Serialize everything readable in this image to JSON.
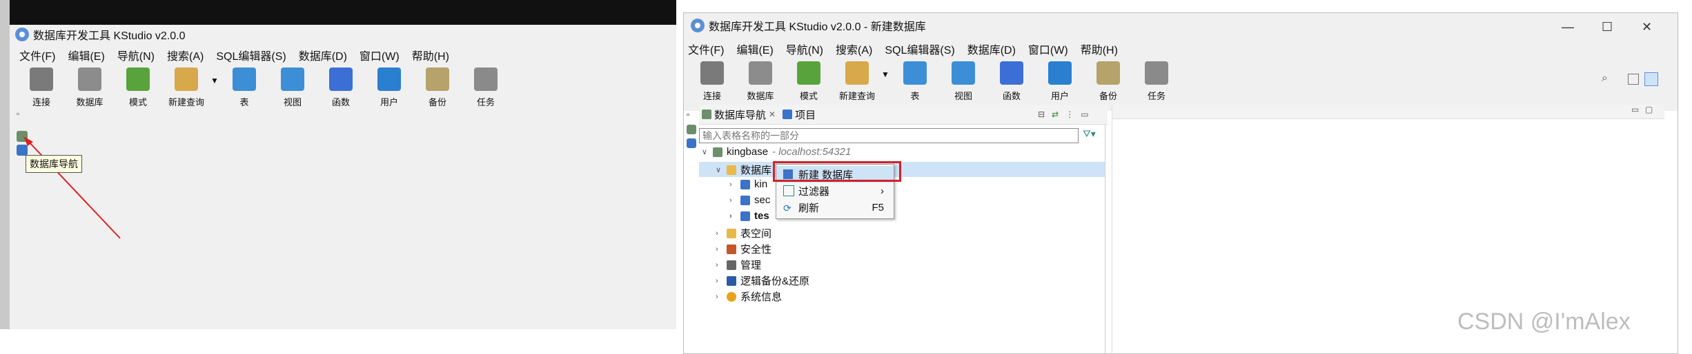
{
  "app": {
    "title_left": "数据库开发工具 KStudio v2.0.0",
    "title_right": "数据库开发工具 KStudio v2.0.0 - 新建数据库"
  },
  "menu": [
    "文件(F)",
    "编辑(E)",
    "导航(N)",
    "搜索(A)",
    "SQL编辑器(S)",
    "数据库(D)",
    "窗口(W)",
    "帮助(H)"
  ],
  "toolbar": [
    {
      "label": "连接",
      "icon": "plug-icon",
      "color": "#7a7a7a"
    },
    {
      "label": "数据库",
      "icon": "database-icon",
      "color": "#8c8c8c"
    },
    {
      "label": "模式",
      "icon": "schema-icon",
      "color": "#58a33b"
    },
    {
      "label": "新建查询",
      "icon": "query-icon",
      "color": "#d7a94b"
    },
    {
      "label": "表",
      "icon": "table-icon",
      "color": "#3c8fd6"
    },
    {
      "label": "视图",
      "icon": "view-icon",
      "color": "#3c8fd6"
    },
    {
      "label": "函数",
      "icon": "function-icon",
      "color": "#3c6fd6"
    },
    {
      "label": "用户",
      "icon": "user-icon",
      "color": "#2a7fd0"
    },
    {
      "label": "备份",
      "icon": "backup-icon",
      "color": "#b5a36b"
    },
    {
      "label": "任务",
      "icon": "task-icon",
      "color": "#8a8a8a"
    }
  ],
  "left_tooltip": "数据库导航",
  "right": {
    "tabs": [
      {
        "label": "数据库导航",
        "icon": "database-navigator-icon"
      },
      {
        "label": "项目",
        "icon": "project-icon"
      }
    ],
    "search_placeholder": "输入表格名称的一部分",
    "tree": [
      {
        "label": "kingbase",
        "suffix": "- localhost:54321",
        "level": 0
      },
      {
        "label": "数据库",
        "level": 1
      },
      {
        "label": "kin",
        "level": 2
      },
      {
        "label": "sec",
        "level": 2
      },
      {
        "label": "tes",
        "level": 2
      },
      {
        "label": "表空间",
        "level": 1
      },
      {
        "label": "安全性",
        "level": 1
      },
      {
        "label": "管理",
        "level": 1
      },
      {
        "label": "逻辑备份&还原",
        "level": 1
      },
      {
        "label": "系统信息",
        "level": 1
      }
    ],
    "context_menu": [
      {
        "label": "新建 数据库",
        "shortcut": "",
        "submenu": false
      },
      {
        "label": "过滤器",
        "shortcut": "",
        "submenu": true
      },
      {
        "label": "刷新",
        "shortcut": "F5",
        "submenu": false
      }
    ]
  },
  "watermark": "CSDN @I'mAlex"
}
